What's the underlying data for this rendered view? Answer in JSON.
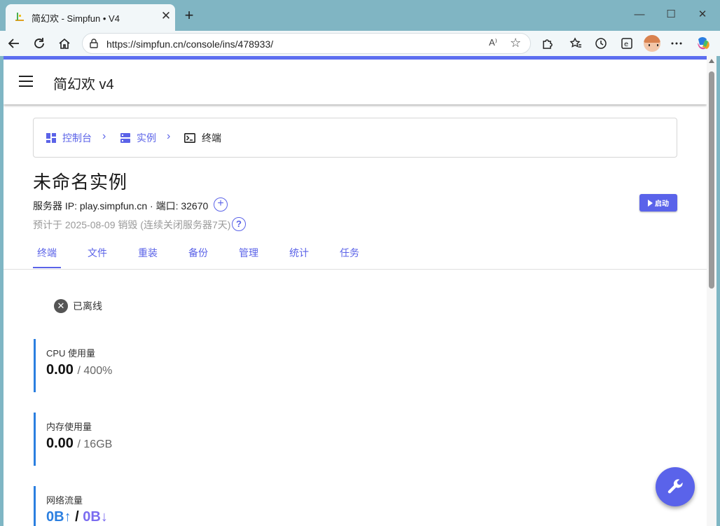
{
  "browser": {
    "tab_title": "简幻欢 - Simpfun • V4",
    "tab_close": "✕",
    "new_tab": "+",
    "url": "https://simpfun.cn/console/ins/478933/",
    "read_aloud": "A⁾"
  },
  "app": {
    "title": "简幻欢 v4"
  },
  "breadcrumb": {
    "items": [
      {
        "label": "控制台",
        "icon": "dashboard-icon"
      },
      {
        "label": "实例",
        "icon": "server-icon"
      },
      {
        "label": "终端",
        "icon": "terminal-icon"
      }
    ]
  },
  "instance": {
    "name": "未命名实例",
    "server_line": "服务器 IP: play.simpfun.cn · 端口: 32670",
    "destroy_line": "预计于 2025-08-09 销毁 (连续关闭服务器7天)",
    "start_label": "启动"
  },
  "tabs": [
    {
      "label": "终端"
    },
    {
      "label": "文件"
    },
    {
      "label": "重装"
    },
    {
      "label": "备份"
    },
    {
      "label": "管理"
    },
    {
      "label": "统计"
    },
    {
      "label": "任务"
    }
  ],
  "status": {
    "text": "已离线"
  },
  "stats": {
    "cpu": {
      "label": "CPU 使用量",
      "value": "0.00",
      "limit": "/ 400%"
    },
    "memory": {
      "label": "内存使用量",
      "value": "0.00",
      "limit": "/ 16GB"
    },
    "network": {
      "label": "网络流量",
      "up": "0B↑",
      "sep": " / ",
      "down": "0B↓"
    }
  },
  "colors": {
    "accent": "#5a63ea",
    "stat_bar": "#2b7fe0"
  }
}
